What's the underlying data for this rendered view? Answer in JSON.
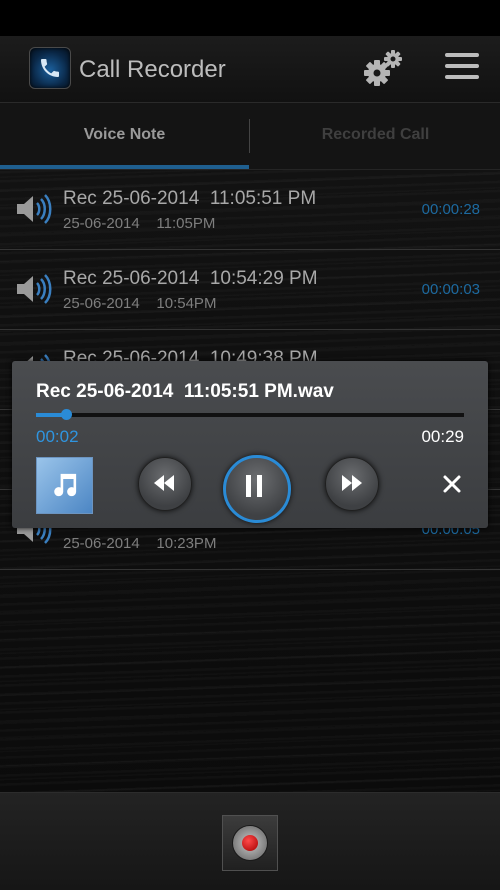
{
  "app": {
    "title": "Call Recorder"
  },
  "tabs": [
    {
      "label": "Voice Note",
      "selected": true
    },
    {
      "label": "Recorded Call",
      "selected": false
    }
  ],
  "recordings": [
    {
      "name": "Rec 25-06-2014  11:05:51 PM",
      "date": "25-06-2014    11:05PM",
      "duration": "00:00:28"
    },
    {
      "name": "Rec 25-06-2014  10:54:29 PM",
      "date": "25-06-2014    10:54PM",
      "duration": "00:00:03"
    },
    {
      "name": "Rec 25-06-2014  10:49:38 PM",
      "date": "",
      "duration": ""
    },
    {
      "name": "",
      "date": "",
      "duration": ""
    },
    {
      "name": "",
      "date": "25-06-2014    10:23PM",
      "duration": "00:00:05"
    }
  ],
  "player": {
    "title": "Rec 25-06-2014  11:05:51 PM.wav",
    "current_time": "00:02",
    "total_time": "00:29",
    "progress": 0.069,
    "state": "playing"
  },
  "colors": {
    "accent": "#2a8bd6",
    "duration_text": "#1d6aa0",
    "record": "#d40000"
  },
  "icons": {
    "app": "phone-icon",
    "settings": "gears-icon",
    "menu": "hamburger-icon",
    "list_item": "speaker-icon",
    "album_art": "music-note-icon",
    "rewind": "rewind-icon",
    "pause": "pause-icon",
    "fast_forward": "fast-forward-icon",
    "close": "close-icon",
    "record": "record-icon"
  }
}
